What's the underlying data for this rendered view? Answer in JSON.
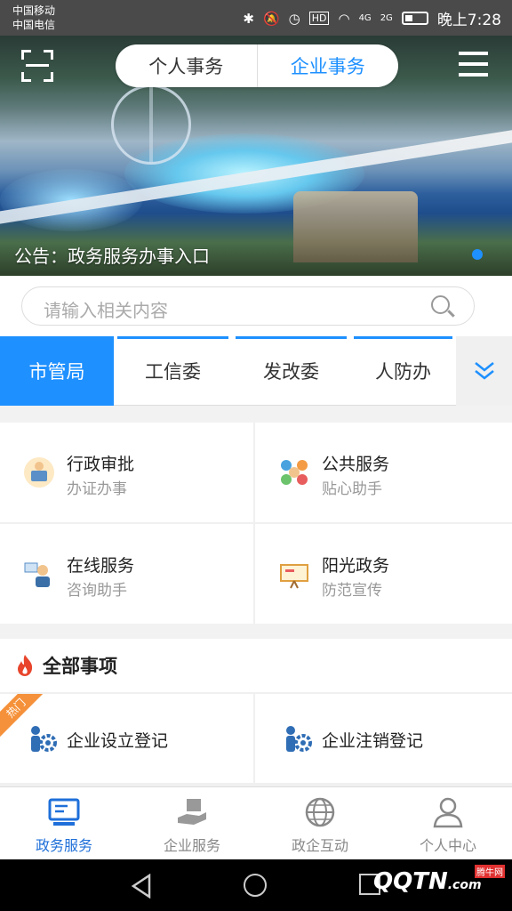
{
  "statusbar": {
    "carrier1": "中国移动",
    "carrier2": "中国电信",
    "time": "晚上7:28",
    "net1": "4G",
    "net2": "2G",
    "hd": "HD"
  },
  "header": {
    "tab_personal": "个人事务",
    "tab_business": "企业事务"
  },
  "banner": {
    "notice": "公告：政务服务办事入口"
  },
  "search": {
    "placeholder": "请输入相关内容"
  },
  "dept_tabs": [
    {
      "label": "市管局",
      "active": true
    },
    {
      "label": "工信委",
      "active": false
    },
    {
      "label": "发改委",
      "active": false
    },
    {
      "label": "人防办",
      "active": false
    }
  ],
  "services": [
    {
      "title": "行政审批",
      "subtitle": "办证办事",
      "icon": "approval-icon"
    },
    {
      "title": "公共服务",
      "subtitle": "贴心助手",
      "icon": "public-service-icon"
    },
    {
      "title": "在线服务",
      "subtitle": "咨询助手",
      "icon": "online-service-icon"
    },
    {
      "title": "阳光政务",
      "subtitle": "防范宣传",
      "icon": "sunshine-gov-icon"
    }
  ],
  "all_items": {
    "title": "全部事项",
    "hot_badge": "热门",
    "items": [
      {
        "label": "企业设立登记",
        "icon": "enterprise-register-icon"
      },
      {
        "label": "企业注销登记",
        "icon": "enterprise-cancel-icon"
      }
    ]
  },
  "tabbar": [
    {
      "label": "政务服务",
      "icon": "monitor-icon",
      "active": true
    },
    {
      "label": "企业服务",
      "icon": "hand-box-icon",
      "active": false
    },
    {
      "label": "政企互动",
      "icon": "globe-icon",
      "active": false
    },
    {
      "label": "个人中心",
      "icon": "person-icon",
      "active": false
    }
  ],
  "watermark": {
    "text": "QQTN",
    "suffix": ".com",
    "badge": "腾牛网"
  },
  "colors": {
    "accent": "#1e90ff",
    "active_tab": "#1e6fd9",
    "hot": "#f5913a"
  }
}
